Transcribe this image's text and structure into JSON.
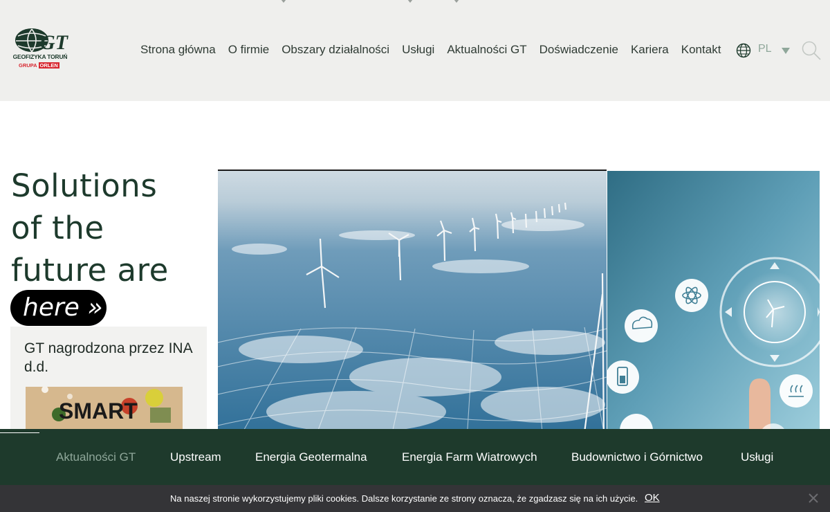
{
  "header": {
    "logo": {
      "mark": "GT",
      "name": "GEOFIZYKA TORUŃ",
      "group": "GRUPA",
      "group_brand": "ORLEN"
    },
    "nav": [
      {
        "label": "Strona główna"
      },
      {
        "label": "O firmie"
      },
      {
        "label": "Obszary działalności"
      },
      {
        "label": "Usługi"
      },
      {
        "label": "Aktualności GT"
      },
      {
        "label": "Doświadczenie"
      },
      {
        "label": "Kariera"
      },
      {
        "label": "Kontakt"
      }
    ],
    "language": {
      "code": "PL",
      "icon": "globe-icon"
    },
    "search_icon": "search-icon"
  },
  "hero": {
    "title_lines": [
      "Solutions",
      "of the",
      "future are"
    ],
    "pill": "here »"
  },
  "news": {
    "title": "GT nagrodzona przez INA d.d.",
    "image_text": "SMART"
  },
  "categories": [
    {
      "label": "Aktualności GT",
      "active": true
    },
    {
      "label": "Upstream",
      "active": false
    },
    {
      "label": "Energia Geotermalna",
      "active": false
    },
    {
      "label": "Energia Farm Wiatrowych",
      "active": false
    },
    {
      "label": "Budownictwo i Górnictwo",
      "active": false
    },
    {
      "label": "Usługi",
      "active": false
    }
  ],
  "cookie": {
    "text": "Na naszej stronie wykorzystujemy pliki cookies. Dalsze korzystanie ze strony oznacza, że zgadzasz się na ich użycie.",
    "ok": "OK",
    "close_icon": "close-icon"
  },
  "colors": {
    "brand_green": "#1e3a2c",
    "accent_sage": "#8fa79a",
    "brand_red": "#d7262f",
    "header_bg": "#efefed",
    "cookie_bg": "#343437"
  }
}
